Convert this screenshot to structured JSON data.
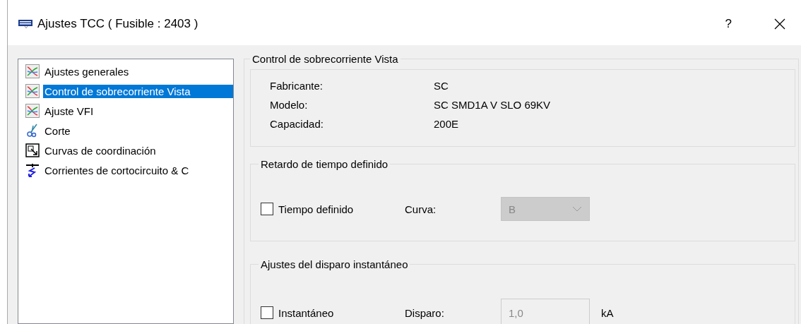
{
  "window": {
    "title": "Ajustes TCC ( Fusible : 2403 )",
    "help": "?"
  },
  "tree": [
    {
      "label": "Ajustes generales",
      "kind": "curve",
      "selected": false
    },
    {
      "label": "Control de sobrecorriente Vista",
      "kind": "curve",
      "selected": true
    },
    {
      "label": "Ajuste VFI",
      "kind": "curve",
      "selected": false
    },
    {
      "label": "Corte",
      "kind": "scissors",
      "selected": false
    },
    {
      "label": "Curvas de coordinación",
      "kind": "zoom",
      "selected": false
    },
    {
      "label": "Corrientes de cortocircuito & C",
      "kind": "shortcircuit",
      "selected": false
    }
  ],
  "section": {
    "title": "Control de sobrecorriente Vista",
    "properties": [
      {
        "label": "Fabricante:",
        "value": "SC"
      },
      {
        "label": "Modelo:",
        "value": "SC SMD1A V SLO 69KV"
      },
      {
        "label": "Capacidad:",
        "value": "200E"
      }
    ]
  },
  "groups": [
    {
      "title": "Retardo de tiempo definido",
      "checkbox": {
        "label": "Tiempo definido",
        "checked": false
      },
      "field": {
        "kind": "dropdown",
        "label": "Curva:",
        "value": "B",
        "disabled": true
      }
    },
    {
      "title": "Ajustes del disparo instantáneo",
      "checkbox": {
        "label": "Instantáneo",
        "checked": false
      },
      "field": {
        "kind": "text",
        "label": "Disparo:",
        "value": "1,0",
        "unit": "kA",
        "disabled": true
      }
    }
  ]
}
